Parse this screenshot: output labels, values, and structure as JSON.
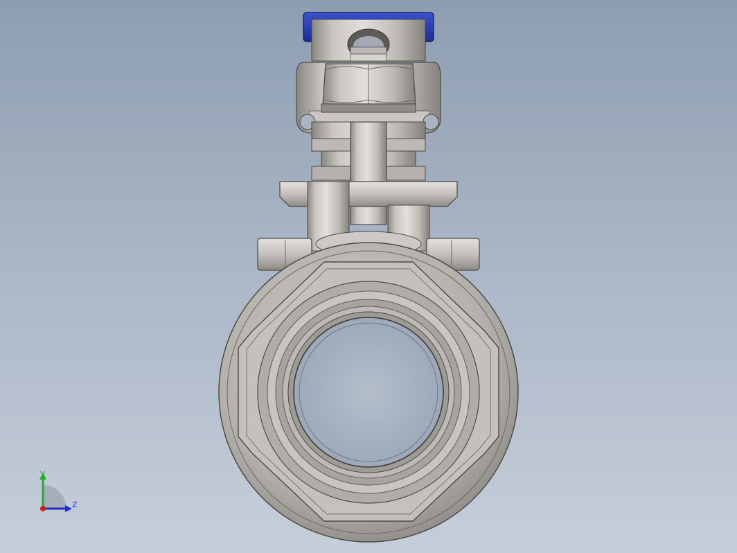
{
  "viewport": {
    "description_colors": {
      "background_top": "#8e9db1",
      "background_bottom": "#c6ced9",
      "handle_grip": "#2238a8",
      "metal_light": "#dcdad6",
      "metal_mid": "#b3b0ab",
      "metal_dark": "#7d7a76"
    }
  },
  "triad": {
    "y_label": "Y",
    "z_label": "Z",
    "y_color": "#1fae1f",
    "z_color": "#1c2fc6",
    "x_color": "#d01c1c"
  }
}
